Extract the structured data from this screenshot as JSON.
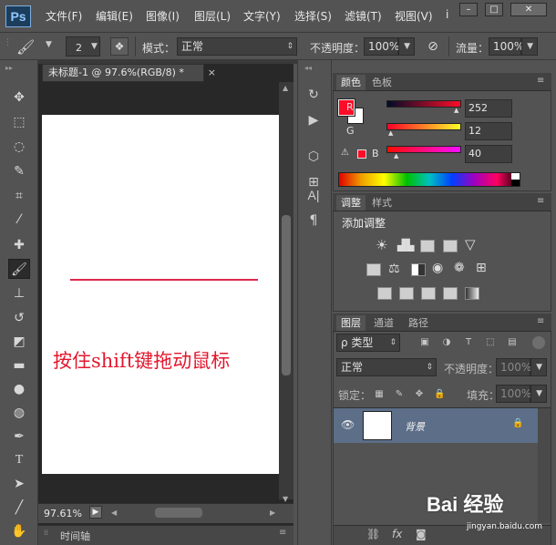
{
  "app": {
    "logo": "Ps"
  },
  "menu": {
    "items": [
      "文件(F)",
      "编辑(E)",
      "图像(I)",
      "图层(L)",
      "文字(Y)",
      "选择(S)",
      "滤镜(T)",
      "视图(V)",
      "i"
    ]
  },
  "window_controls": {
    "minimize": "–",
    "restore": "□",
    "close": "✕"
  },
  "options": {
    "brush_size": "2",
    "mode_label": "模式：",
    "mode_value": "正常",
    "opacity_label": "不透明度：",
    "opacity_value": "100%",
    "flow_label": "流量：",
    "flow_value": "100%"
  },
  "document": {
    "tab_title": "未标题-1 @ 97.6%(RGB/8) *",
    "canvas_text": "按住shift键拖动鼠标",
    "zoom": "97.61%",
    "timeline_label": "时间轴"
  },
  "color_panel": {
    "tabs": [
      "颜色",
      "色板"
    ],
    "r_label": "R",
    "g_label": "G",
    "b_label": "B",
    "r": "252",
    "g": "12",
    "b": "40",
    "foreground": "#fc0c28",
    "background": "#ffffff"
  },
  "adjust_panel": {
    "tabs": [
      "调整",
      "样式"
    ],
    "title": "添加调整"
  },
  "layers_panel": {
    "tabs": [
      "图层",
      "通道",
      "路径"
    ],
    "filter_label": "ρ 类型",
    "blend_mode": "正常",
    "opacity_label": "不透明度：",
    "opacity_value": "100%",
    "lock_label": "锁定：",
    "fill_label": "填充：",
    "fill_value": "100%",
    "layers": [
      {
        "name": "背景"
      }
    ]
  },
  "watermark": {
    "brand": "Bai 经验",
    "url": "jingyan.baidu.com"
  }
}
